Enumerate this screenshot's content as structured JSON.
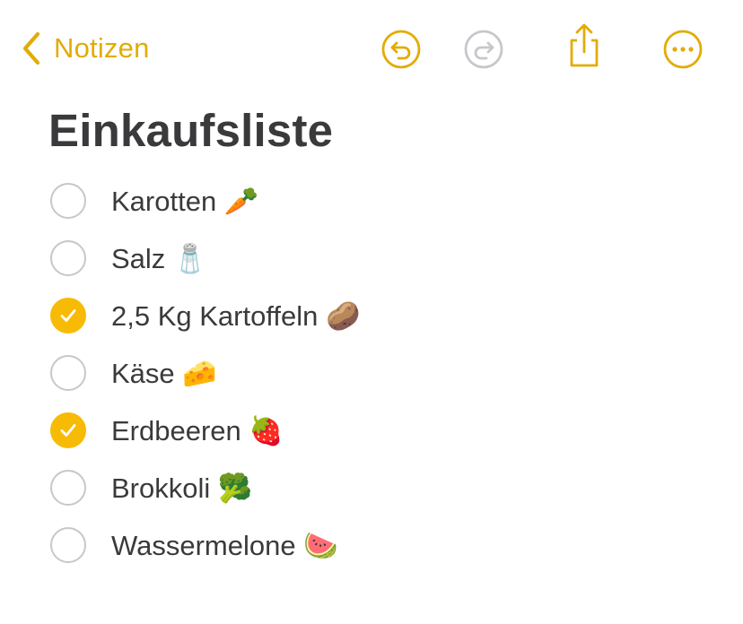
{
  "colors": {
    "accent": "#e2ac05",
    "check_fill": "#f8bb05",
    "unchecked_border": "#c7c7cc",
    "redo_disabled": "#c7c7cc",
    "text": "#3a3a3c"
  },
  "toolbar": {
    "back_label": "Notizen",
    "back_icon": "chevron-left-icon",
    "undo_icon": "undo-icon",
    "redo_icon": "redo-icon",
    "share_icon": "share-icon",
    "more_icon": "ellipsis-circle-icon"
  },
  "note": {
    "title": "Einkaufsliste",
    "items": [
      {
        "text": "Karotten 🥕",
        "checked": false
      },
      {
        "text": "Salz 🧂",
        "checked": false
      },
      {
        "text": "2,5 Kg Kartoffeln 🥔",
        "checked": true
      },
      {
        "text": "Käse 🧀",
        "checked": false
      },
      {
        "text": "Erdbeeren 🍓",
        "checked": true
      },
      {
        "text": "Brokkoli 🥦",
        "checked": false
      },
      {
        "text": "Wassermelone 🍉",
        "checked": false
      }
    ]
  }
}
